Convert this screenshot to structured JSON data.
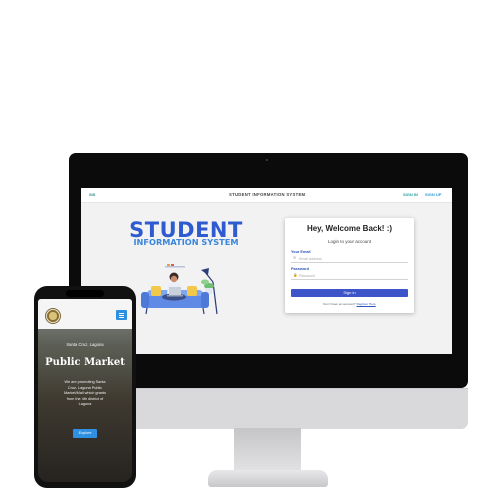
{
  "desktop": {
    "nav": {
      "brand": "SIS",
      "title": "STUDENT INFORMATION SYSTEM",
      "sign_in": "SIGN IN",
      "sign_up": "SIGN UP"
    },
    "hero": {
      "title": "STUDENT",
      "subtitle": "INFORMATION SYSTEM"
    },
    "login": {
      "heading": "Hey, Welcome Back! :)",
      "subheading": "Login to your account",
      "email_label": "Your Email",
      "email_placeholder": "Email Address",
      "password_label": "Password",
      "password_placeholder": "Password",
      "submit_label": "Sign in",
      "signup_prompt": "Don't have an account?",
      "signup_link": "Register Here"
    }
  },
  "mobile": {
    "location": "Santa Cruz, Laguna",
    "title": "Public Market",
    "description": "We are promoting Santa Cruz, Laguna Public Market/Mall which grants from the 4th district of Laguna",
    "cta_label": "Explore"
  },
  "colors": {
    "primary_blue": "#2f5bd0",
    "accent_teal": "#27a3a0",
    "button_blue": "#3d55c8",
    "mobile_accent": "#2f8fe0"
  }
}
